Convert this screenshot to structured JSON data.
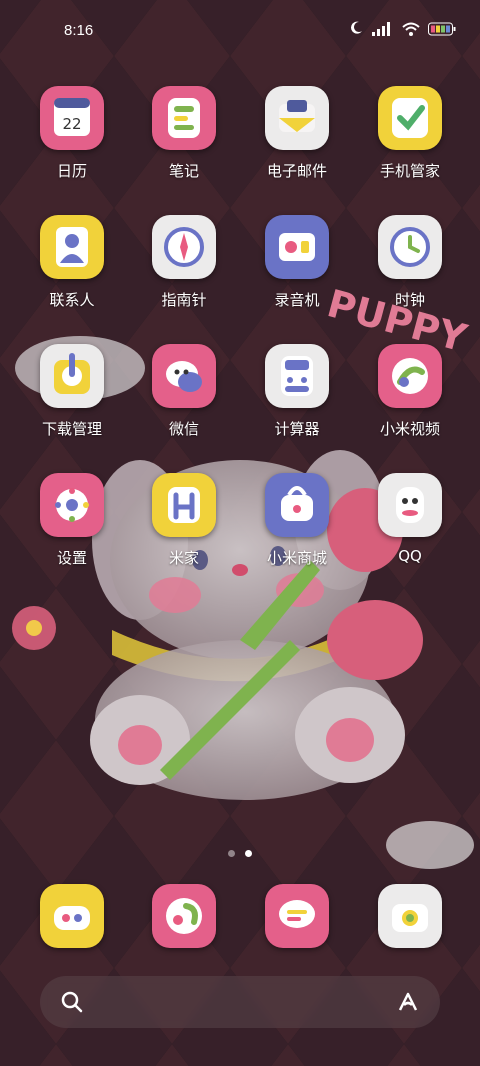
{
  "status_bar": {
    "time": "8:16",
    "icons": [
      "moon-icon",
      "signal-icon",
      "wifi-icon",
      "battery-icon"
    ]
  },
  "apps": [
    {
      "label": "日历",
      "icon": "calendar-icon",
      "badge_text": "22",
      "color": "#e4608a"
    },
    {
      "label": "笔记",
      "icon": "notes-icon",
      "color": "#e4608a"
    },
    {
      "label": "电子邮件",
      "icon": "mail-icon",
      "color": "#ecebeb"
    },
    {
      "label": "手机管家",
      "icon": "security-icon",
      "color": "#f1d23a"
    },
    {
      "label": "联系人",
      "icon": "contacts-icon",
      "color": "#f1d23a"
    },
    {
      "label": "指南针",
      "icon": "compass-icon",
      "color": "#ecebeb"
    },
    {
      "label": "录音机",
      "icon": "recorder-icon",
      "color": "#6a73c6"
    },
    {
      "label": "时钟",
      "icon": "clock-icon",
      "color": "#ecebeb"
    },
    {
      "label": "下载管理",
      "icon": "download-icon",
      "color": "#ecebeb"
    },
    {
      "label": "微信",
      "icon": "wechat-icon",
      "color": "#e4608a"
    },
    {
      "label": "计算器",
      "icon": "calculator-icon",
      "color": "#ecebeb"
    },
    {
      "label": "小米视频",
      "icon": "video-icon",
      "color": "#e4608a"
    },
    {
      "label": "设置",
      "icon": "settings-icon",
      "color": "#e4608a"
    },
    {
      "label": "米家",
      "icon": "mijia-icon",
      "color": "#f1d23a"
    },
    {
      "label": "小米商城",
      "icon": "mi-store-icon",
      "color": "#6a73c6"
    },
    {
      "label": "QQ",
      "icon": "qq-icon",
      "color": "#ecebeb"
    }
  ],
  "dock": [
    {
      "icon": "phone-icon",
      "color": "#f1d23a"
    },
    {
      "icon": "gallery-icon",
      "color": "#e4608a"
    },
    {
      "icon": "messages-icon",
      "color": "#e4608a"
    },
    {
      "icon": "camera-icon",
      "color": "#ecebeb"
    }
  ],
  "pages": {
    "count": 2,
    "active": 2
  },
  "searchbar": {
    "left_icon": "search-icon",
    "right_icon": "assistant-icon"
  },
  "wallpaper": {
    "text": "PUPPY",
    "colors": {
      "diamond": "#4a2a33",
      "dark": "#141012"
    }
  }
}
